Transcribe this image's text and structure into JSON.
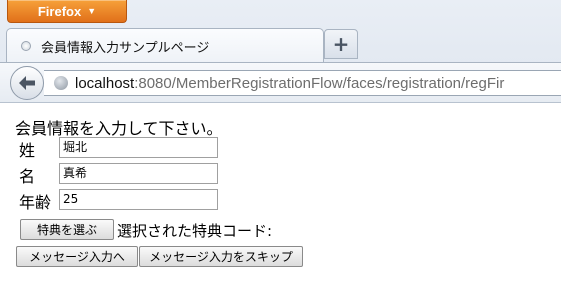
{
  "browser": {
    "menu_button": "Firefox",
    "tab_title": "会員情報入力サンプルページ",
    "new_tab": "+",
    "url_host": "localhost",
    "url_rest": ":8080/MemberRegistrationFlow/faces/registration/regFir"
  },
  "page": {
    "heading": "会員情報を入力して下さい。",
    "fields": {
      "last_name_label": "姓",
      "last_name_value": "堀北",
      "first_name_label": "名",
      "first_name_value": "真希",
      "age_label": "年齢",
      "age_value": "25"
    },
    "choose_benefit_button": "特典を選ぶ",
    "selected_benefit_label": "選択された特典コード:",
    "to_message_button": "メッセージ入力へ",
    "skip_message_button": "メッセージ入力をスキップ"
  },
  "colors": {
    "firefox_orange": "#e1701a",
    "chrome_blue": "#dfe6ef"
  },
  "icons": [
    "back-arrow-icon",
    "site-identity-icon",
    "tab-favicon-icon",
    "dropdown-arrow-icon"
  ]
}
